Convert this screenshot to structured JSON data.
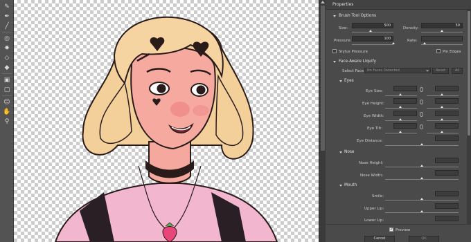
{
  "toolbar": {
    "tools": [
      {
        "name": "forward-warp-tool-icon",
        "glyph": "✎"
      },
      {
        "name": "reconstruct-tool-icon",
        "glyph": "✒"
      },
      {
        "name": "smooth-tool-icon",
        "glyph": "╱"
      },
      {
        "name": "twirl-tool-icon",
        "glyph": "◎"
      },
      {
        "name": "pucker-tool-icon",
        "glyph": "✸"
      },
      {
        "name": "bloat-tool-icon",
        "glyph": "◇"
      },
      {
        "name": "push-left-tool-icon",
        "glyph": "◆"
      },
      {
        "name": "freeze-mask-tool-icon",
        "glyph": "▣"
      },
      {
        "name": "thaw-mask-tool-icon",
        "glyph": "▢"
      },
      {
        "name": "face-tool-icon",
        "glyph": "☺"
      },
      {
        "name": "hand-tool-icon",
        "glyph": "✋"
      },
      {
        "name": "zoom-tool-icon",
        "glyph": "⚲"
      }
    ]
  },
  "panel": {
    "title": "Properties",
    "brush": {
      "section": "Brush Tool Options",
      "size_label": "Size:",
      "size_value": "500",
      "density_label": "Density:",
      "density_value": "50",
      "pressure_label": "Pressure:",
      "pressure_value": "100",
      "rate_label": "Rate:",
      "stylus_label": "Stylus Pressure",
      "pin_edges_label": "Pin Edges"
    },
    "face": {
      "section": "Face-Aware Liquify",
      "select_face_label": "Select Face:",
      "select_face_value": "No Faces Detected",
      "reset_label": "Reset",
      "all_label": "All",
      "eyes": {
        "section": "Eyes",
        "rows": [
          "Eye Size:",
          "Eye Height:",
          "Eye Width:",
          "Eye Tilt:",
          "Eye Distance:"
        ]
      },
      "nose": {
        "section": "Nose",
        "rows": [
          "Nose Height:",
          "Nose Width:"
        ]
      },
      "mouth": {
        "section": "Mouth",
        "rows": [
          "Smile:",
          "Upper Lip:",
          "Lower Lip:"
        ]
      }
    },
    "preview_label": "Preview",
    "cancel_label": "Cancel",
    "ok_label": "OK"
  }
}
